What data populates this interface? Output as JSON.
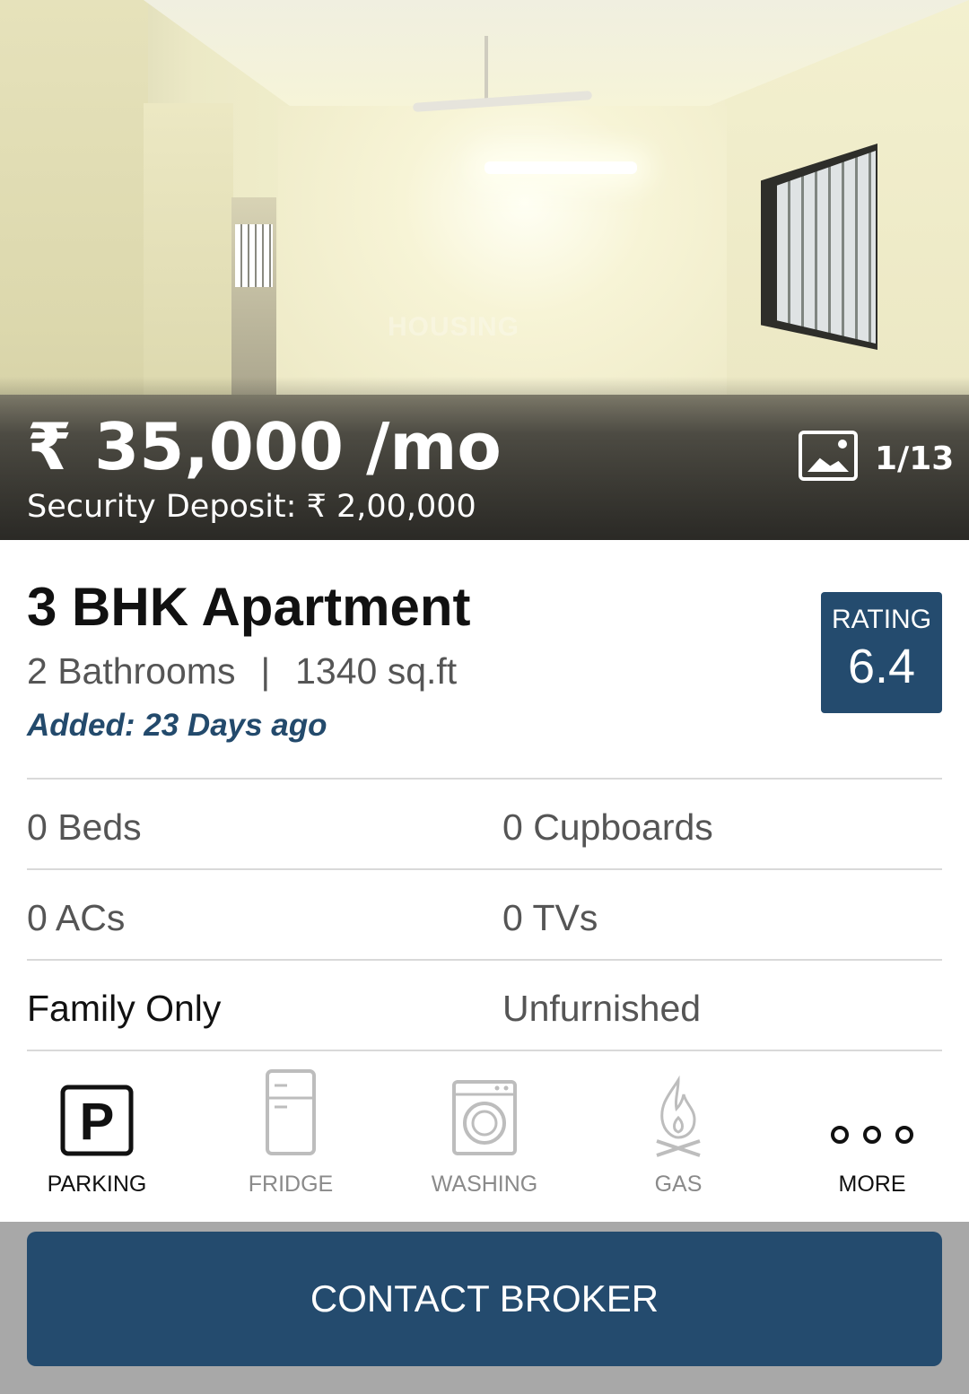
{
  "hero": {
    "watermark": "HOUSING",
    "price": "₹ 35,000 /mo",
    "deposit": "Security Deposit: ₹ 2,00,000",
    "gallery_icon": "image-gallery-icon",
    "gallery_count": "1/13"
  },
  "listing": {
    "title": "3 BHK Apartment",
    "bathrooms": "2 Bathrooms",
    "separator": "|",
    "area": "1340 sq.ft",
    "added": "Added: 23 Days ago"
  },
  "rating": {
    "label": "RATING",
    "value": "6.4"
  },
  "features": {
    "beds": "0 Beds",
    "cupboards": "0 Cupboards",
    "acs": "0 ACs",
    "tvs": "0 TVs",
    "tenant": "Family Only",
    "furnishing": "Unfurnished"
  },
  "amenities": [
    {
      "label": "PARKING",
      "icon": "parking-icon",
      "available": true
    },
    {
      "label": "FRIDGE",
      "icon": "fridge-icon",
      "available": false
    },
    {
      "label": "WASHING",
      "icon": "washing-machine-icon",
      "available": false
    },
    {
      "label": "GAS",
      "icon": "gas-flame-icon",
      "available": false
    },
    {
      "label": "MORE",
      "icon": "more-dots-icon",
      "available": true
    }
  ],
  "actions": {
    "contact_label": "CONTACT BROKER"
  },
  "colors": {
    "primary": "#244b6e",
    "accent_text": "#234a6c",
    "inactive": "#8a8a8a"
  }
}
